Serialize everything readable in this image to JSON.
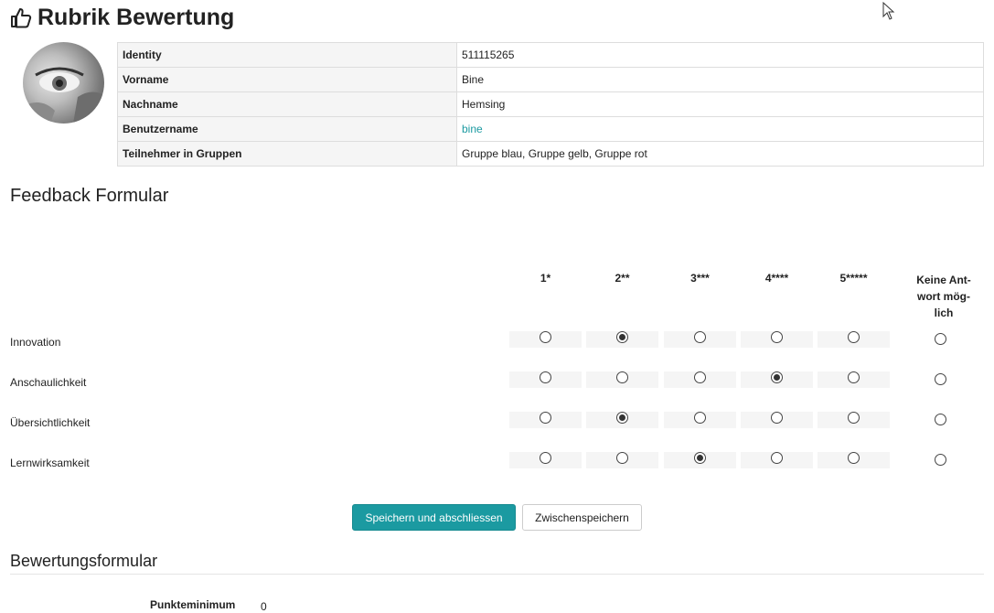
{
  "page": {
    "title": "Rubrik Bewertung",
    "title_icon": "thumbs-up-icon"
  },
  "identity": {
    "rows": [
      {
        "label": "Identity",
        "value": "511115265"
      },
      {
        "label": "Vorname",
        "value": "Bine"
      },
      {
        "label": "Nachname",
        "value": "Hemsing"
      },
      {
        "label": "Benutzername",
        "value": "bine"
      },
      {
        "label": "Teilnehmer in Gruppen",
        "value": "Gruppe blau, Gruppe gelb, Gruppe rot"
      }
    ]
  },
  "feedback": {
    "title": "Feedback Formular",
    "columns": [
      "1*",
      "2**",
      "3***",
      "4****",
      "5*****"
    ],
    "no_answer_label": "Keine Ant- wort mög- lich",
    "no_answer_lines": [
      "Keine Ant-",
      "wort mög-",
      "lich"
    ],
    "rows": [
      {
        "label": "Innovation",
        "selected": 2
      },
      {
        "label": "Anschaulichkeit",
        "selected": 4
      },
      {
        "label": "Übersichtlichkeit",
        "selected": 2
      },
      {
        "label": "Lernwirksamkeit",
        "selected": 3
      }
    ]
  },
  "actions": {
    "save_close_label": "Speichern und abschliessen",
    "save_draft_label": "Zwischenspeichern"
  },
  "assessment": {
    "title": "Bewertungsformular",
    "score_min_label": "Punkteminimum",
    "score_min_value": "0"
  },
  "colors": {
    "accent": "#1b9aa1",
    "label_bg": "#f5f5f5",
    "border": "#dddddd"
  }
}
